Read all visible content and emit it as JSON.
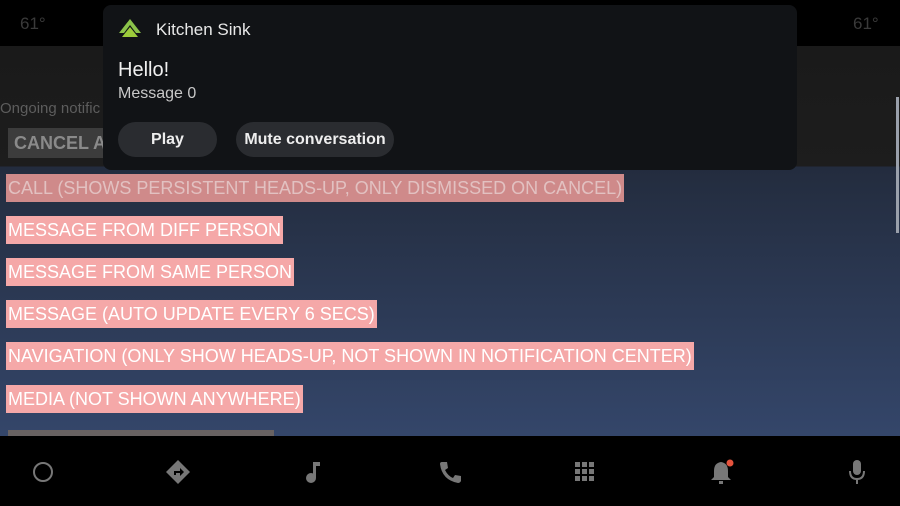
{
  "status": {
    "temp_left": "61°",
    "temp_right": "61°"
  },
  "app": {
    "ongoing_label": "Ongoing notific",
    "cancel_label": "CANCEL A",
    "buttons": [
      "CALL (SHOWS PERSISTENT HEADS-UP, ONLY DISMISSED ON CANCEL)",
      "MESSAGE FROM DIFF PERSON",
      "MESSAGE FROM SAME PERSON",
      "MESSAGE (AUTO UPDATE EVERY 6 SECS)",
      "NAVIGATION (ONLY SHOW HEADS-UP, NOT SHOWN IN NOTIFICATION CENTER)",
      "MEDIA (NOT SHOWN ANYWHERE)"
    ]
  },
  "notification": {
    "app_name": "Kitchen Sink",
    "title": "Hello!",
    "message": "Message 0",
    "actions": [
      "Play",
      "Mute conversation"
    ],
    "icon": "kitchen-sink-chevron-icon",
    "accent": "#8bc34a"
  },
  "nav": {
    "icons": [
      "home-icon",
      "navigation-icon",
      "music-icon",
      "phone-icon",
      "apps-grid-icon",
      "notifications-bell-icon",
      "microphone-icon"
    ],
    "badge_color": "#e5533d"
  }
}
